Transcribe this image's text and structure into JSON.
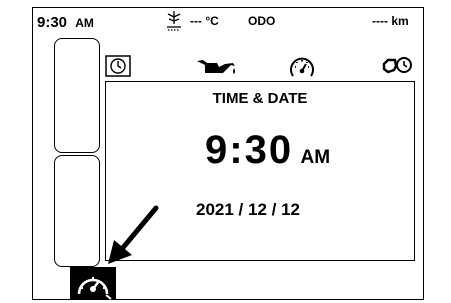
{
  "status": {
    "clock": "9:30",
    "clock_ampm": "AM",
    "temperature": "--- °C",
    "odo_label": "ODO",
    "distance": "---- km"
  },
  "icons": {
    "clock_tab": "clock-icon",
    "oil": "oil-can-icon",
    "speedometer": "speedometer-icon",
    "service": "service-icon",
    "frost": "frost-warning-icon",
    "cruise": "cruise-control-icon"
  },
  "panel": {
    "title": "TIME & DATE",
    "time": "9:30",
    "time_ampm": "AM",
    "date": "2021 / 12 / 12"
  }
}
